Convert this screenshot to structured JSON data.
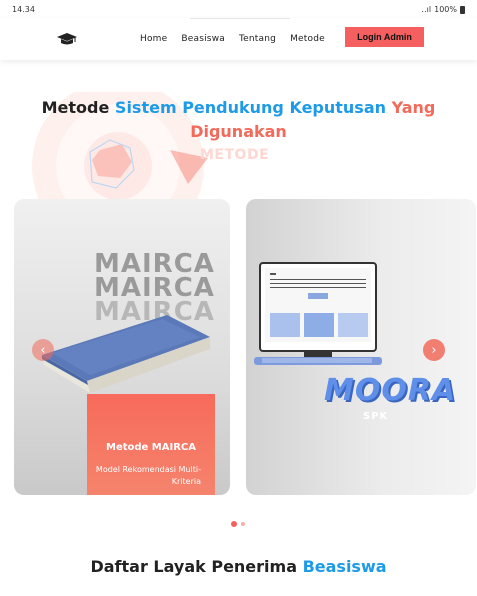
{
  "status_bar": {
    "time": "14.34",
    "signal": "‥ıl",
    "battery": "100%"
  },
  "nav": {
    "logo_icon": "graduation-cap-icon",
    "links": [
      "Home",
      "Beasiswa",
      "Tentang",
      "Metode"
    ],
    "login_label": "Login Admin"
  },
  "hero": {
    "title_part1": "Metode",
    "title_part2": "Sistem Pendukung Keputusan",
    "title_part3": "Yang",
    "title_part4": "Digunakan",
    "subtitle": "METODE"
  },
  "carousel": {
    "card1": {
      "watermark": "MAIRCA",
      "title": "Metode MAIRCA",
      "description": "Model Rekomendasi Multi-Kriteria"
    },
    "card2": {
      "logo_text": "MOORA",
      "logo_sub": "SPK"
    },
    "prev_icon": "chevron-left-icon",
    "next_icon": "chevron-right-icon",
    "prev_glyph": "‹",
    "next_glyph": "›",
    "active_slide": 1,
    "slide_count": 2
  },
  "section": {
    "title_part1": "Daftar Layak Penerima",
    "title_part2": "Beasiswa"
  },
  "colors": {
    "accent": "#f55f5f",
    "blue": "#1e9be8",
    "orange": "#f26a5a"
  }
}
